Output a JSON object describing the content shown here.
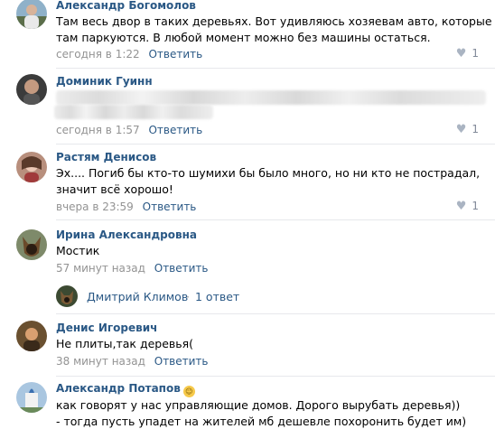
{
  "comments": [
    {
      "author": "Александр Богомолов",
      "lines": [
        "Там весь двор в таких деревьях. Вот удивляюсь хозяевам авто, которые",
        "там паркуются. В любой момент можно без машины остаться."
      ],
      "time": "сегодня в 1:22",
      "reply_label": "Ответить",
      "likes": "1"
    },
    {
      "author": "Доминик Гуинн",
      "time": "сегодня в 1:57",
      "reply_label": "Ответить",
      "likes": "1"
    },
    {
      "author": "Растям Денисов",
      "lines": [
        "Эх.... Погиб бы кто-то шумихи бы было много, но ни кто не пострадал,",
        "значит всё хорошо!"
      ],
      "time": "вчера в 23:59",
      "reply_label": "Ответить",
      "likes": "1"
    },
    {
      "author": "Ирина Александровна",
      "lines": [
        "Мостик"
      ],
      "time": "57 минут назад",
      "reply_label": "Ответить"
    },
    {
      "author": "Денис Игоревич",
      "lines": [
        "Не плиты,так деревья("
      ],
      "time": "38 минут назад",
      "reply_label": "Ответить"
    },
    {
      "author": "Александр Потапов",
      "lines": [
        "как говорят у нас управляющие домов. Дорого вырубать деревья))",
        "- тогда пусть упадет на жителей мб дешевле похоронить будет им)"
      ]
    }
  ],
  "thread": {
    "name": "Дмитрий Климов",
    "separator": "·",
    "count": "1 ответ"
  },
  "icons": {
    "like": "heart-icon",
    "emoji": "smile-emoji-icon"
  },
  "colors": {
    "link": "#2a5885",
    "meta": "#939393",
    "divider": "#e7e8ec"
  }
}
